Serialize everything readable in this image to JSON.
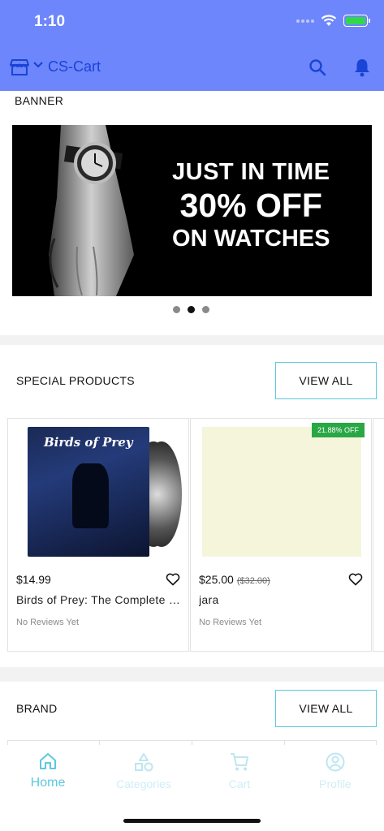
{
  "status_bar": {
    "time": "1:10",
    "battery_color": "#32d74b"
  },
  "app_bar": {
    "title": "CS-Cart",
    "background": "#6e86fb",
    "icons": [
      "store-icon",
      "chevron-down-icon",
      "search-icon",
      "bell-icon"
    ]
  },
  "banner": {
    "label": "BANNER",
    "headline_1": "JUST IN TIME",
    "headline_2": "30% OFF",
    "headline_3": "ON WATCHES",
    "page_count": 3,
    "active_page": 2
  },
  "special_products": {
    "label": "SPECIAL PRODUCTS",
    "view_all": "VIEW ALL",
    "items": [
      {
        "price": "$14.99",
        "old_price": "",
        "name": "Birds of Prey: The Complete Series",
        "image_title": "Birds of Prey",
        "reviews": "No Reviews Yet",
        "discount": ""
      },
      {
        "price": "$25.00",
        "old_price": "($32.00)",
        "name": "jara",
        "reviews": "No Reviews Yet",
        "discount": "21.88% OFF"
      }
    ]
  },
  "brand": {
    "label": "BRAND",
    "view_all": "VIEW ALL"
  },
  "tab_bar": {
    "tabs": [
      {
        "label": "Home",
        "icon": "home-icon",
        "active": true
      },
      {
        "label": "Categories",
        "icon": "categories-icon",
        "active": false
      },
      {
        "label": "Cart",
        "icon": "cart-icon",
        "active": false
      },
      {
        "label": "Profile",
        "icon": "profile-icon",
        "active": false
      }
    ],
    "accent": "#5cc8e0"
  }
}
